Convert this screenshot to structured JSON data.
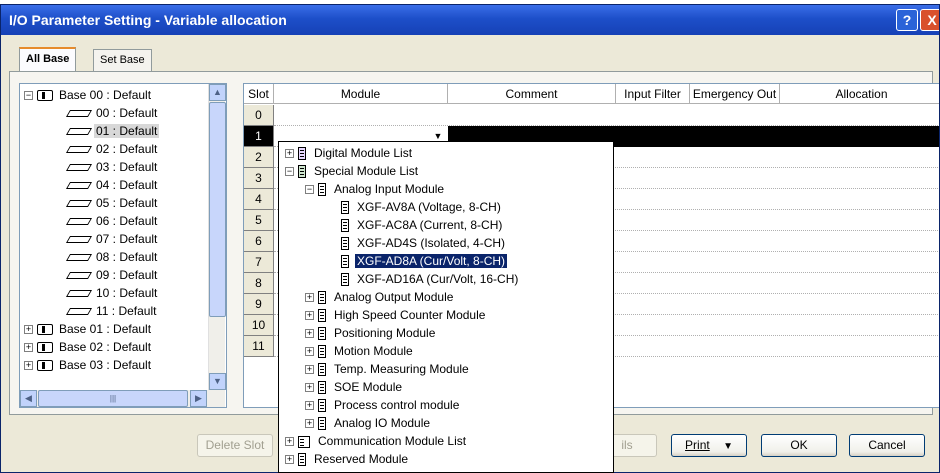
{
  "window": {
    "title": "I/O Parameter Setting - Variable allocation",
    "help_label": "?",
    "close_label": "X"
  },
  "tabs": [
    {
      "label": "All Base",
      "active": true
    },
    {
      "label": "Set Base",
      "active": false
    }
  ],
  "tree": {
    "items": [
      {
        "label": "Base 00 : Default",
        "type": "base",
        "expander": "−"
      },
      {
        "label": "00 : Default",
        "type": "slot"
      },
      {
        "label": "01 : Default",
        "type": "slot",
        "selected": true
      },
      {
        "label": "02 : Default",
        "type": "slot"
      },
      {
        "label": "03 : Default",
        "type": "slot"
      },
      {
        "label": "04 : Default",
        "type": "slot"
      },
      {
        "label": "05 : Default",
        "type": "slot"
      },
      {
        "label": "06 : Default",
        "type": "slot"
      },
      {
        "label": "07 : Default",
        "type": "slot"
      },
      {
        "label": "08 : Default",
        "type": "slot"
      },
      {
        "label": "09 : Default",
        "type": "slot"
      },
      {
        "label": "10 : Default",
        "type": "slot"
      },
      {
        "label": "11 : Default",
        "type": "slot"
      },
      {
        "label": "Base 01 : Default",
        "type": "base",
        "expander": "+"
      },
      {
        "label": "Base 02 : Default",
        "type": "base",
        "expander": "+"
      },
      {
        "label": "Base 03 : Default",
        "type": "base",
        "expander": "+"
      }
    ]
  },
  "grid": {
    "columns": [
      "Slot",
      "Module",
      "Comment",
      "Input Filter",
      "Emergency Out",
      "Allocation"
    ],
    "slots": [
      "0",
      "1",
      "2",
      "3",
      "4",
      "5",
      "6",
      "7",
      "8",
      "9",
      "10",
      "11"
    ],
    "selected_slot": "1"
  },
  "dropdown": {
    "items": [
      {
        "label": "Digital Module List",
        "expander": "+",
        "level": 0,
        "icon": "digital"
      },
      {
        "label": "Special Module List",
        "expander": "−",
        "level": 0,
        "icon": "special"
      },
      {
        "label": "Analog Input Module",
        "expander": "−",
        "level": 1,
        "icon": "module"
      },
      {
        "label": "XGF-AV8A (Voltage, 8-CH)",
        "level": 2,
        "icon": "module"
      },
      {
        "label": "XGF-AC8A (Current, 8-CH)",
        "level": 2,
        "icon": "module"
      },
      {
        "label": "XGF-AD4S (Isolated, 4-CH)",
        "level": 2,
        "icon": "module"
      },
      {
        "label": "XGF-AD8A (Cur/Volt, 8-CH)",
        "level": 2,
        "icon": "module",
        "selected": true
      },
      {
        "label": "XGF-AD16A (Cur/Volt, 16-CH)",
        "level": 2,
        "icon": "module"
      },
      {
        "label": "Analog Output Module",
        "expander": "+",
        "level": 1,
        "icon": "module"
      },
      {
        "label": "High Speed Counter Module",
        "expander": "+",
        "level": 1,
        "icon": "module"
      },
      {
        "label": "Positioning Module",
        "expander": "+",
        "level": 1,
        "icon": "module"
      },
      {
        "label": "Motion Module",
        "expander": "+",
        "level": 1,
        "icon": "module"
      },
      {
        "label": "Temp. Measuring Module",
        "expander": "+",
        "level": 1,
        "icon": "module"
      },
      {
        "label": "SOE Module",
        "expander": "+",
        "level": 1,
        "icon": "module"
      },
      {
        "label": "Process control module",
        "expander": "+",
        "level": 1,
        "icon": "module"
      },
      {
        "label": "Analog IO Module",
        "expander": "+",
        "level": 1,
        "icon": "module"
      },
      {
        "label": "Communication Module List",
        "expander": "+",
        "level": 0,
        "icon": "comm"
      },
      {
        "label": "Reserved Module",
        "expander": "+",
        "level": 0,
        "icon": "module"
      }
    ]
  },
  "buttons": {
    "delete_slot": "Delete Slot",
    "details_partial": "ils",
    "print": "Print",
    "print_arrow": "▼",
    "ok": "OK",
    "cancel": "Cancel"
  }
}
